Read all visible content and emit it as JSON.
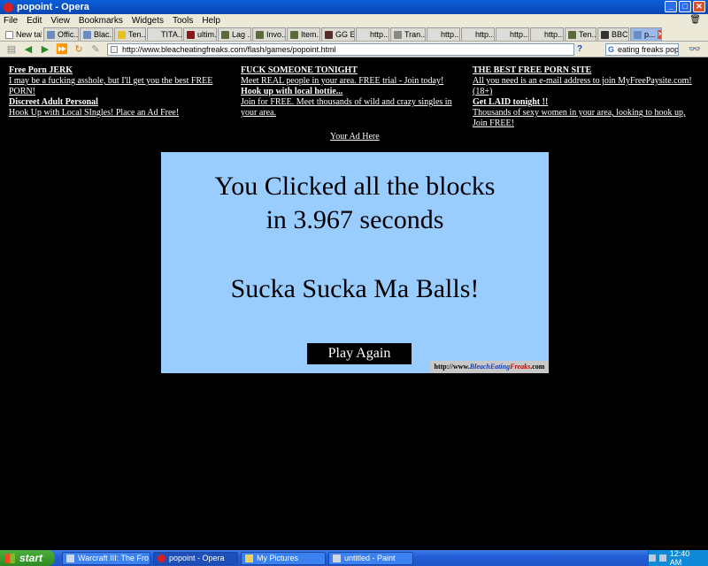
{
  "window": {
    "title": "popoint - Opera"
  },
  "menu": [
    "File",
    "Edit",
    "View",
    "Bookmarks",
    "Widgets",
    "Tools",
    "Help"
  ],
  "tabs": [
    {
      "label": "New tab"
    },
    {
      "label": "Offic..."
    },
    {
      "label": "Blac..."
    },
    {
      "label": "Ten..."
    },
    {
      "label": "TITA..."
    },
    {
      "label": "ultim..."
    },
    {
      "label": "Lag ..."
    },
    {
      "label": "Invo..."
    },
    {
      "label": "Item..."
    },
    {
      "label": "GG E..."
    },
    {
      "label": "http..."
    },
    {
      "label": "Tran..."
    },
    {
      "label": "http..."
    },
    {
      "label": "http..."
    },
    {
      "label": "http..."
    },
    {
      "label": "http..."
    },
    {
      "label": "Ten..."
    },
    {
      "label": "BBC ..."
    },
    {
      "label": "p..."
    }
  ],
  "address": {
    "url": "http://www.bleacheatingfreaks.com/flash/games/popoint.html",
    "help": "?",
    "search": "eating freaks popoint"
  },
  "ads": {
    "col1": [
      {
        "head": "Free Porn JERK",
        "body": "I may be a fucking asshole, but I'll get you the best FREE PORN!"
      },
      {
        "head": "Discreet Adult Personal",
        "body": "Hook Up with Local SIngles! Place an Ad Free!"
      }
    ],
    "col2": [
      {
        "head": "FUCK SOMEONE TONIGHT",
        "body": "Meet REAL people in your area. FREE trial - Join today!"
      },
      {
        "head": "Hook up with local hottie...",
        "body": "Join for FREE. Meet thousands of wild and crazy singles in your area."
      }
    ],
    "col3": [
      {
        "head": "THE BEST FREE PORN SITE",
        "body": "All you need is an e-mail address to join MyFreePaysite.com! (18+)"
      },
      {
        "head": "Get LAID tonight !!",
        "body": "Thousands of sexy women in your area, looking to hook up, Join FREE!"
      }
    ],
    "your_ad": "Your Ad Here"
  },
  "game": {
    "line1": "You Clicked all the blocks",
    "line2": "in 3.967 seconds",
    "line3": "Sucka Sucka Ma Balls!",
    "play_again": "Play Again",
    "brand_prefix": "http://www.",
    "brand_bleach": "BleachEating",
    "brand_freaks": "Freaks",
    "brand_suffix": ".com"
  },
  "taskbar": {
    "start": "start",
    "items": [
      "Warcraft III: The Fro...",
      "popoint - Opera",
      "My Pictures",
      "untitled - Paint"
    ],
    "time": "12:40 AM"
  }
}
